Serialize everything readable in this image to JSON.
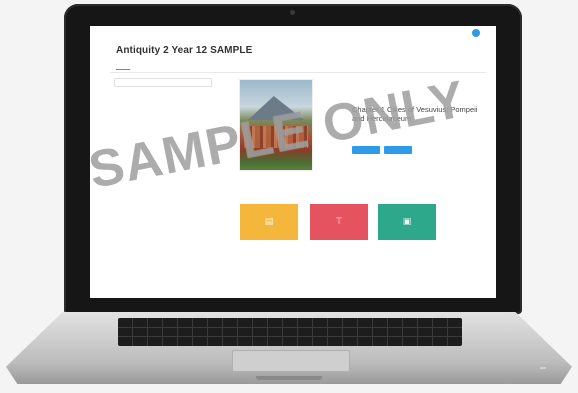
{
  "app": {
    "brand": "",
    "top_nav": "",
    "user_name": "",
    "avatar_initial": ""
  },
  "page": {
    "title": "Antiquity 2 Year 12 SAMPLE"
  },
  "tabs": [],
  "actions": [],
  "sidebar": {
    "search_placeholder": "",
    "heading": "",
    "items": []
  },
  "chapter": {
    "label": "",
    "title": "Chapter 1 Cities of Vesuvius: Pompeii and Herculaneum",
    "buttons": []
  },
  "cards": [
    {
      "label": "",
      "icon": "book-icon",
      "caption": "",
      "color": "#f4b73c"
    },
    {
      "label": "",
      "icon": "pin-icon",
      "caption": "",
      "color": "#e55260"
    },
    {
      "label": "",
      "icon": "gallery-icon",
      "caption": "",
      "color": "#2ea88a"
    }
  ],
  "watermark": "SAMPLE ONLY",
  "colors": {
    "accent": "#2d9be8",
    "card_yellow": "#f4b73c",
    "card_red": "#e55260",
    "card_green": "#2ea88a"
  }
}
